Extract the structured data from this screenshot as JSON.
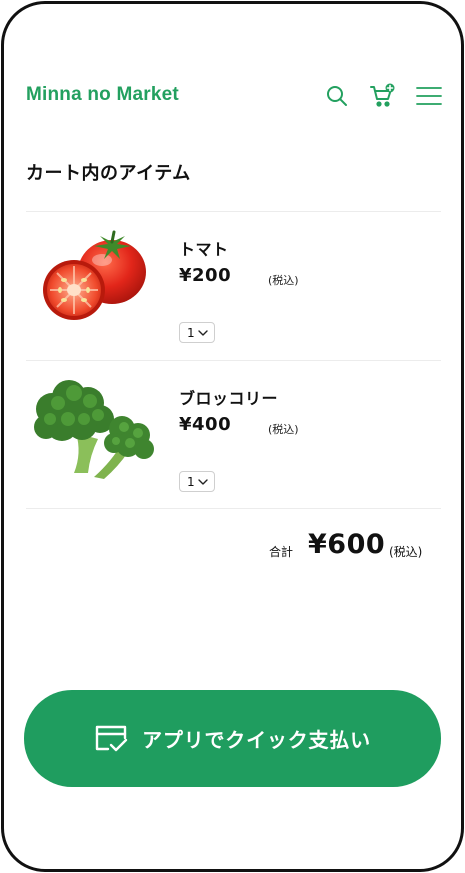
{
  "header": {
    "brand": "Minna no Market",
    "icons": [
      "search-icon",
      "cart-add-icon",
      "menu-icon"
    ]
  },
  "cart": {
    "title": "カート内のアイテム",
    "items": [
      {
        "name": "トマト",
        "price": "¥200",
        "tax": "(税込)",
        "quantity": "1",
        "image": "tomato"
      },
      {
        "name": "ブロッコリー",
        "price": "¥400",
        "tax": "(税込)",
        "quantity": "1",
        "image": "broccoli"
      }
    ],
    "total_label": "合計",
    "total_value": "¥600",
    "total_tax": "(税込)"
  },
  "actions": {
    "quick_pay_label": "アプリでクイック支払い"
  },
  "colors": {
    "brand": "#23a05f",
    "button": "#1f9d5f"
  }
}
